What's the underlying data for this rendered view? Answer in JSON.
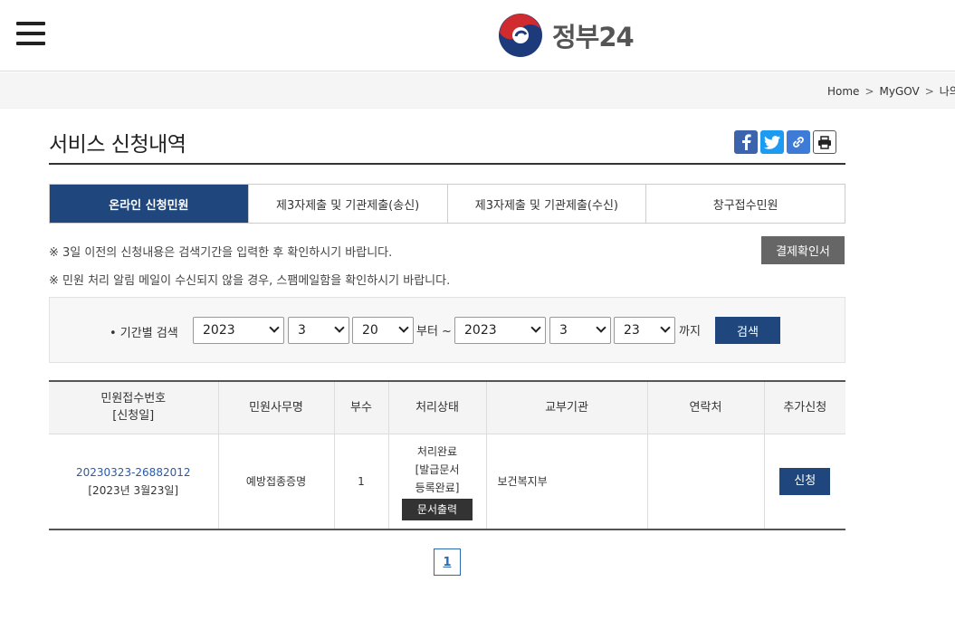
{
  "header": {
    "logo_text": "정부24",
    "menu_icon": "hamburger-icon"
  },
  "breadcrumb": {
    "home": "Home",
    "mygov": "MyGOV",
    "current": "나의"
  },
  "page": {
    "title": "서비스 신청내역"
  },
  "share": {
    "icons": [
      "facebook-icon",
      "twitter-icon",
      "link-icon",
      "print-icon"
    ]
  },
  "tabs": [
    {
      "label": "온라인 신청민원",
      "active": true
    },
    {
      "label": "제3자제출 및 기관제출(송신)",
      "active": false
    },
    {
      "label": "제3자제출 및 기관제출(수신)",
      "active": false
    },
    {
      "label": "창구접수민원",
      "active": false
    }
  ],
  "notes": {
    "note1": "※ 3일 이전의 신청내용은 검색기간을 입력한 후 확인하시기 바랍니다.",
    "note2": "※ 민원 처리 알림 메일이 수신되지 않을 경우, 스팸메일함을 확인하시기 바랍니다.",
    "confirm_button": "결제확인서"
  },
  "search": {
    "label": "• 기간별 검색",
    "from_year": "2023",
    "from_month": "3",
    "from_day": "20",
    "from_text": "부터 ~",
    "to_year": "2023",
    "to_month": "3",
    "to_day": "23",
    "to_text": "까지",
    "button": "검색"
  },
  "table": {
    "headers": {
      "recno_line1": "민원접수번호",
      "recno_line2": "[신청일]",
      "name": "민원사무명",
      "copies": "부수",
      "status": "처리상태",
      "agency": "교부기관",
      "contact": "연락처",
      "extra": "추가신청"
    },
    "rows": [
      {
        "recno": "20230323-26882012",
        "date": "[2023년 3월23일]",
        "name": "예방접종증명",
        "copies": "1",
        "status_line1": "처리완료",
        "status_line2": "[발급문서",
        "status_line3": "등록완료]",
        "print_button": "문서출력",
        "agency": "보건복지부",
        "contact": "",
        "apply_button": "신청"
      }
    ]
  },
  "pagination": {
    "current": "1"
  },
  "colors": {
    "primary": "#1f477d",
    "link": "#2a5aa8"
  }
}
